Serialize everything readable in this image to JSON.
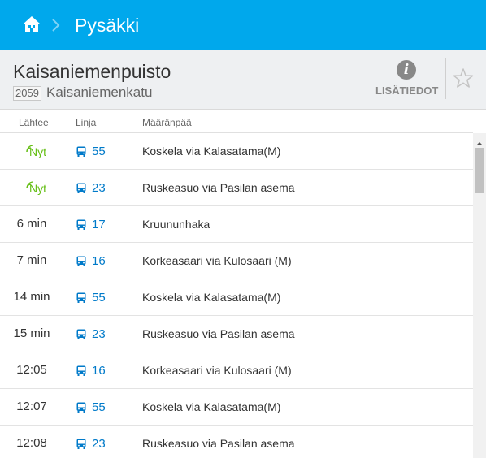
{
  "header": {
    "title": "Pysäkki",
    "home_icon": "home-icon",
    "separator_icon": "chevron-right-icon",
    "bg_color": "#00a8ec"
  },
  "stop": {
    "name": "Kaisaniemenpuisto",
    "code": "2059",
    "street": "Kaisaniemenkatu",
    "info_label": "LISÄTIEDOT",
    "info_icon": "info-icon",
    "favourite_icon": "star-outline-icon"
  },
  "columns": {
    "time": "Lähtee",
    "line": "Linja",
    "destination": "Määränpää"
  },
  "colors": {
    "realtime": "#64be14",
    "line": "#007ac9"
  },
  "departures": [
    {
      "time": "Nyt",
      "realtime": true,
      "line": "55",
      "destination": "Koskela via Kalasatama(M)"
    },
    {
      "time": "Nyt",
      "realtime": true,
      "line": "23",
      "destination": "Ruskeasuo via Pasilan asema"
    },
    {
      "time": "6 min",
      "realtime": false,
      "line": "17",
      "destination": "Kruununhaka"
    },
    {
      "time": "7 min",
      "realtime": false,
      "line": "16",
      "destination": "Korkeasaari via Kulosaari (M)"
    },
    {
      "time": "14 min",
      "realtime": false,
      "line": "55",
      "destination": "Koskela via Kalasatama(M)"
    },
    {
      "time": "15 min",
      "realtime": false,
      "line": "23",
      "destination": "Ruskeasuo via Pasilan asema"
    },
    {
      "time": "12:05",
      "realtime": false,
      "line": "16",
      "destination": "Korkeasaari via Kulosaari (M)"
    },
    {
      "time": "12:07",
      "realtime": false,
      "line": "55",
      "destination": "Koskela via Kalasatama(M)"
    },
    {
      "time": "12:08",
      "realtime": false,
      "line": "23",
      "destination": "Ruskeasuo via Pasilan asema"
    }
  ]
}
